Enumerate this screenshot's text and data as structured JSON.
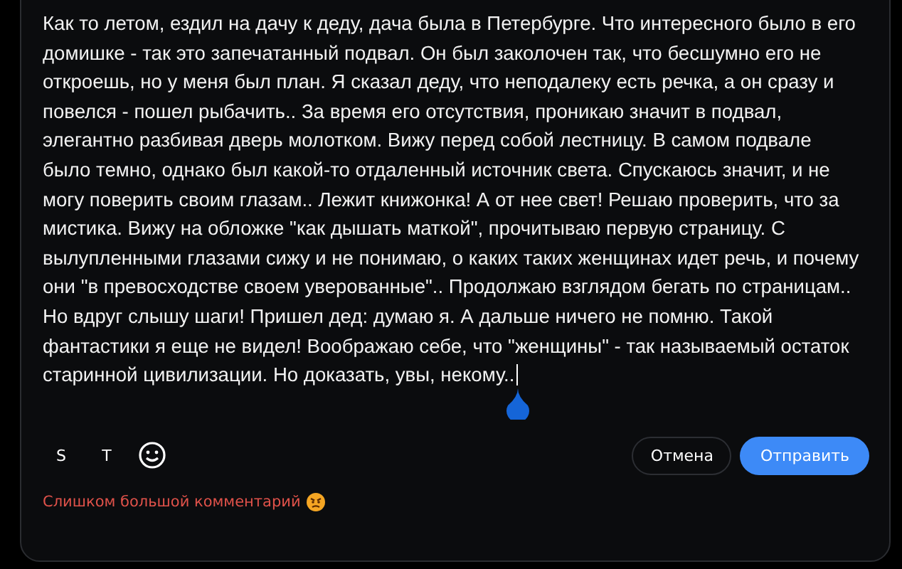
{
  "comment": {
    "text": "Как то летом, ездил на дачу к деду, дача была в Петербурге. Что интересного было в его домишке - так это запечатанный подвал. Он был заколочен так, что бесшумно его не откроешь, но у меня был план. Я сказал деду, что неподалеку есть речка, а он сразу и повелся - пошел рыбачить.. За время его отсутствия, проникаю значит в подвал, элегантно разбивая дверь молотком. Вижу перед собой лестницу. В самом подвале было темно, однако был какой-то отдаленный источник света. Спускаюсь значит, и не могу поверить своим глазам.. Лежит книжонка! А от нее свет! Решаю проверить, что за мистика. Вижу на обложке \"как дышать маткой\", прочитываю первую страницу. С вылупленными глазами сижу и не понимаю, о каких таких женщинах идет речь, и почему они \"в превосходстве своем уверованные\".. Продолжаю взглядом бегать по страницам.. Но вдруг слышу шаги! Пришел дед: думаю я. А дальше ничего не помню. Такой фантастики я еще не видел! Воображаю себе, что \"женщины\" - так называемый остаток старинной цивилизации. Но доказать, увы, некому.."
  },
  "format_buttons": [
    {
      "label": "S",
      "kind": "text"
    },
    {
      "label": "T",
      "kind": "text"
    },
    {
      "kind": "emoji"
    }
  ],
  "buttons": [
    {
      "label": "Отмена",
      "kind": "secondary"
    },
    {
      "label": "Отправить",
      "kind": "primary"
    }
  ],
  "error": {
    "text": "Слишком большой комментарий"
  }
}
